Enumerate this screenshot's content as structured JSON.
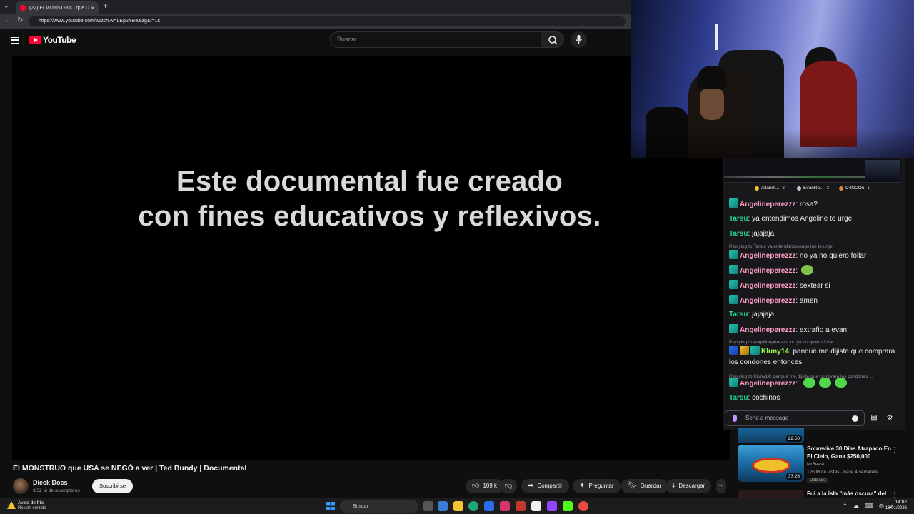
{
  "browser": {
    "tab_title": "(22) El MONSTRUO que USA se N...",
    "tab_close": "×",
    "new_tab": "+",
    "url": "https://www.youtube.com/watch?v=LEp2YBealzg&t=1s"
  },
  "youtube": {
    "logo_text": "YouTube",
    "search_placeholder": "Buscar"
  },
  "video": {
    "overlay_line1": "Este documental fue creado",
    "overlay_line2": "con fines educativos y reflexivos.",
    "title": "El MONSTRUO que USA se NEGÓ a ver | Ted Bundy | Documental",
    "channel_name": "Dieck Docs",
    "subscribers": "3.52 M de suscriptores",
    "subscribe_label": "Suscribirse",
    "likes": "109 k",
    "share_label": "Compartir",
    "ask_label": "Preguntar",
    "save_label": "Guardar",
    "download_label": "Descargar",
    "more_label": "•••"
  },
  "chat": {
    "leaderboard": [
      {
        "name": "Allanm...",
        "count": "3",
        "color": "#f4c430"
      },
      {
        "name": "EvanRo...",
        "count": "2",
        "color": "#c8c8d0"
      },
      {
        "name": "C4NCOo",
        "count": "1",
        "color": "#d9843a"
      }
    ],
    "messages": [
      {
        "user": "Angelineperezzz",
        "text": "rosa?"
      },
      {
        "user": "Tarsu",
        "text": "ya entendimos Angeline te urge"
      },
      {
        "user": "Tarsu",
        "text": "jajajaja"
      },
      {
        "reply": "Replying to Tarsu: ya entendimos Angeline te urge"
      },
      {
        "user": "Angelineperezzz",
        "text": "no ya no quiero follar"
      },
      {
        "user": "Angelineperezzz",
        "text": ""
      },
      {
        "user": "Angelineperezzz",
        "text": "sextear si"
      },
      {
        "user": "Angelineperezzz",
        "text": "amen"
      },
      {
        "user": "Tarsu",
        "text": "jajajaja"
      },
      {
        "user": "Angelineperezzz",
        "text": "extraño a evan"
      },
      {
        "reply": "Replying to Angelineperezzz: no ya no quiero follar"
      },
      {
        "user": "Kluny14",
        "text": "panqué me dijiste que comprara los condones entonces"
      },
      {
        "reply": "Replying to Kluny14: panqué me dijiste que comprara los condones ..."
      },
      {
        "user": "Angelineperezzz",
        "text": ""
      },
      {
        "user": "Tarsu",
        "text": "cochinos"
      }
    ],
    "input_placeholder": "Send a message"
  },
  "recommendations": [
    {
      "duration": "22:50"
    },
    {
      "title": "Sobrevive 30 Días Atrapado En El Cielo, Gana $250,000",
      "channel": "MrBeast",
      "meta": "126 M de vistas · hace 4 semanas",
      "badge": "Doblado",
      "duration": "37:26"
    },
    {
      "title": "Fui a la isla \"más oscura\" del"
    }
  ],
  "taskbar": {
    "weather_line1": "Aviso de frío",
    "weather_line2": "Reción emitida",
    "search": "Buscar",
    "time": "14:02",
    "date": "18/01/2026"
  }
}
